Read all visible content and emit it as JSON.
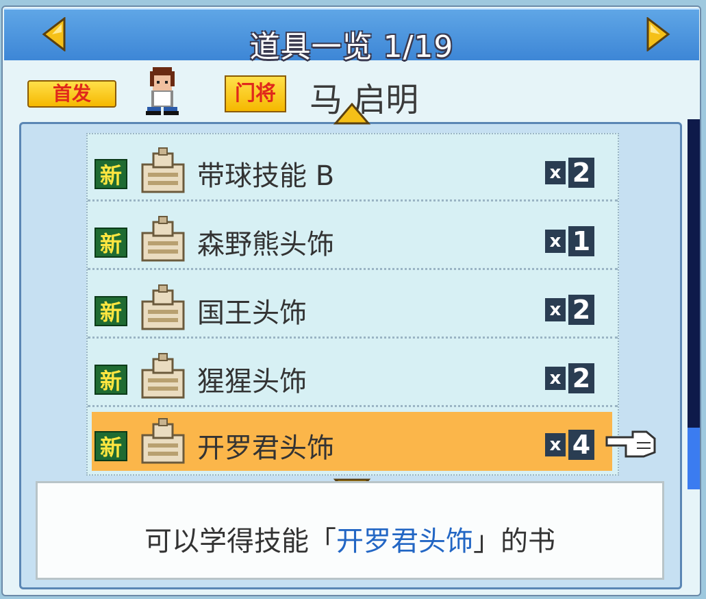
{
  "header": {
    "title": "道具一览 1/19"
  },
  "player": {
    "starter_badge": "首发",
    "position_badge": "门将",
    "name": "马 启明"
  },
  "items": [
    {
      "badge": "新",
      "name": "带球技能 B",
      "qty_x": "x",
      "qty": "2",
      "selected": false
    },
    {
      "badge": "新",
      "name": "森野熊头饰",
      "qty_x": "x",
      "qty": "1",
      "selected": false
    },
    {
      "badge": "新",
      "name": "国王头饰",
      "qty_x": "x",
      "qty": "2",
      "selected": false
    },
    {
      "badge": "新",
      "name": "猩猩头饰",
      "qty_x": "x",
      "qty": "2",
      "selected": false
    },
    {
      "badge": "新",
      "name": "开罗君头饰",
      "qty_x": "x",
      "qty": "4",
      "selected": true
    }
  ],
  "description": {
    "prefix": "可以学得技能「",
    "highlight": "开罗君头饰",
    "suffix": "」的书"
  },
  "colors": {
    "header": "#3d86d6",
    "list_bg": "#d7f0f4",
    "selected": "#fbb64a",
    "badge_new": "#1f6b32",
    "highlight_text": "#2266c4"
  },
  "icons": [
    "left-arrow-icon",
    "right-arrow-icon",
    "scroll-up-icon",
    "scroll-down-icon",
    "hand-pointer-icon",
    "book-icon",
    "player-avatar"
  ]
}
